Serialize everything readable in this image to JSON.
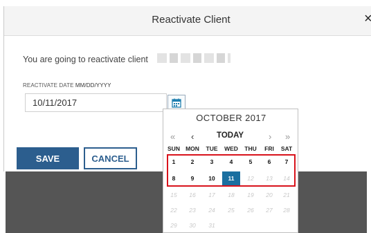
{
  "modal": {
    "title": "Reactivate Client",
    "close_glyph": "×",
    "message": "You are going to reactivate client",
    "field_label": "REACTIVATE DATE",
    "field_format": "MM/DD/YYYY",
    "date_value": "10/11/2017",
    "save_label": "SAVE",
    "cancel_label": "CANCEL",
    "calendar_icon": "calendar-icon"
  },
  "calendar": {
    "month_label": "OCTOBER 2017",
    "nav": {
      "prev_year": "«",
      "prev_month": "‹",
      "today": "TODAY",
      "next_month": "›",
      "next_year": "»"
    },
    "weekdays": [
      "SUN",
      "MON",
      "TUE",
      "WED",
      "THU",
      "FRI",
      "SAT"
    ],
    "weeks": [
      [
        "1",
        "2",
        "3",
        "4",
        "5",
        "6",
        "7"
      ],
      [
        "8",
        "9",
        "10",
        "11",
        "12",
        "13",
        "14"
      ],
      [
        "15",
        "16",
        "17",
        "18",
        "19",
        "20",
        "21"
      ],
      [
        "22",
        "23",
        "24",
        "25",
        "26",
        "27",
        "28"
      ],
      [
        "29",
        "30",
        "31"
      ]
    ],
    "selected_day": "11",
    "last_enabled_day": 11
  },
  "colors": {
    "primary": "#2c5e8e",
    "selected": "#1a6fa0",
    "highlight": "#d8121b"
  }
}
